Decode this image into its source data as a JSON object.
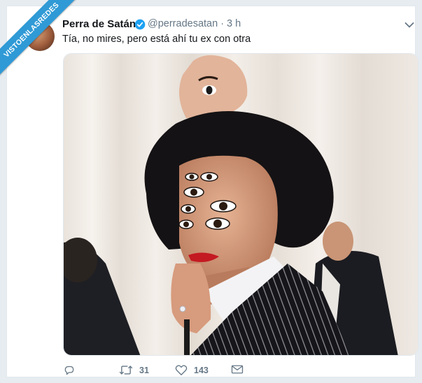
{
  "tweet": {
    "display_name": "Perra de Satán",
    "handle": "@perradesatan",
    "time": "· 3 h",
    "text": "Tía, no mires, pero está ahí tu ex con otra",
    "retweets": "31",
    "likes": "143"
  },
  "watermark": {
    "text": "VISTOENLASREDES"
  },
  "icons": {
    "verified": "verified-badge-icon",
    "menu": "chevron-down-icon",
    "reply": "reply-icon",
    "retweet": "retweet-icon",
    "like": "heart-icon",
    "message": "envelope-icon"
  },
  "colors": {
    "verified": "#1da1f2",
    "text": "#14171a",
    "muted": "#657786",
    "watermark": "#2f9ad6",
    "background": "#e6ecf0"
  }
}
